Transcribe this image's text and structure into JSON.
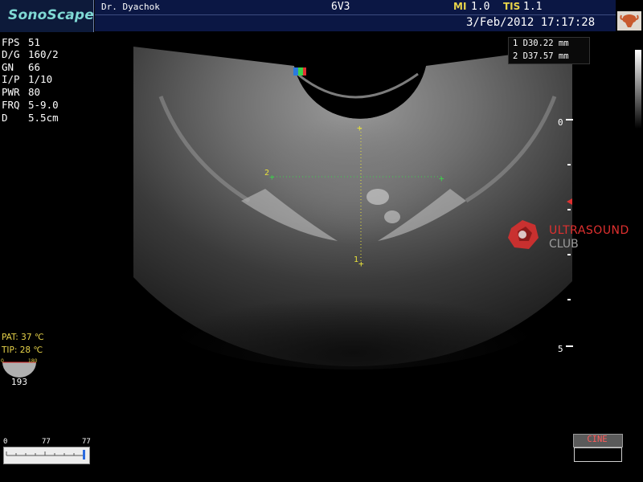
{
  "header": {
    "logo": "SonoScape",
    "operator": "Dr. Dyachok",
    "probe": "6V3",
    "mi_label": "MI",
    "mi_value": "1.0",
    "tis_label": "TIS",
    "tis_value": "1.1",
    "datetime": "3/Feb/2012 17:17:28"
  },
  "params": [
    {
      "key": "FPS",
      "value": "51"
    },
    {
      "key": "D/G",
      "value": "160/2"
    },
    {
      "key": "GN",
      "value": "66"
    },
    {
      "key": "I/P",
      "value": "1/10"
    },
    {
      "key": "PWR",
      "value": "80"
    },
    {
      "key": "FRQ",
      "value": "5-9.0"
    },
    {
      "key": "D",
      "value": "5.5cm"
    }
  ],
  "measurements": [
    {
      "text": "1 D30.22 mm"
    },
    {
      "text": "2 D37.57 mm"
    }
  ],
  "depth_scale": {
    "top_label": "0",
    "bottom_label": "5"
  },
  "markers": {
    "m1": "1",
    "m2": "2"
  },
  "watermark": {
    "line1": "ULTRASOUND",
    "line2": "CLUB",
    "accent": "#e0302f"
  },
  "temps": {
    "pat": "PAT: 37 ℃",
    "tip": "TIP: 28 ℃"
  },
  "probe_angle": {
    "min": "0",
    "max": "180",
    "value": "193"
  },
  "slider": {
    "min": "0",
    "mid": "77",
    "max": "77"
  },
  "cine": {
    "label": "CINE"
  },
  "colors": {
    "header_bg": "#0b1744",
    "caliper": "#e8e23a",
    "caliper2": "#3bd24a",
    "param_label": "#e8d44a"
  }
}
